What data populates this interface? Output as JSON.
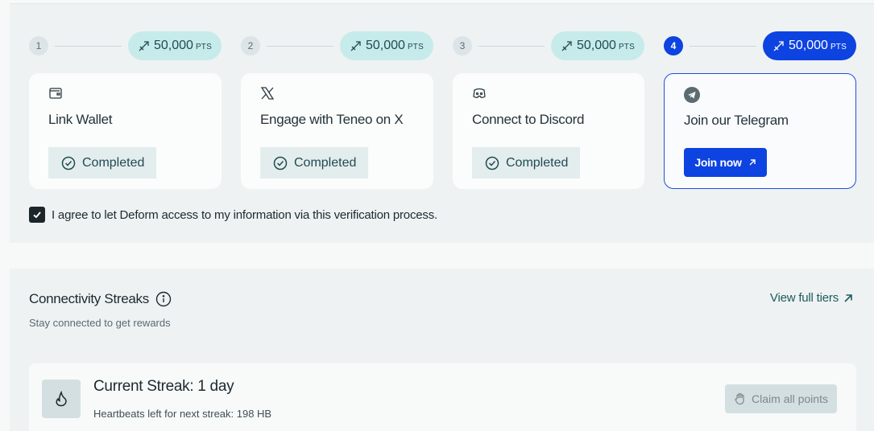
{
  "steps": [
    {
      "number": "1",
      "points": "50,000",
      "unit": "PTS",
      "title": "Link Wallet",
      "icon": "wallet-icon",
      "status": "Completed"
    },
    {
      "number": "2",
      "points": "50,000",
      "unit": "PTS",
      "title": "Engage with Teneo on X",
      "icon": "x-logo-icon",
      "status": "Completed"
    },
    {
      "number": "3",
      "points": "50,000",
      "unit": "PTS",
      "title": "Connect to Discord",
      "icon": "discord-icon",
      "status": "Completed"
    },
    {
      "number": "4",
      "points": "50,000",
      "unit": "PTS",
      "title": "Join our Telegram",
      "icon": "telegram-icon",
      "action": "Join now"
    }
  ],
  "agreement": {
    "checked": true,
    "text": "I agree to let Deform access to my information via this verification process."
  },
  "streaks": {
    "title": "Connectivity Streaks",
    "subtitle": "Stay connected to get rewards",
    "view_tiers": "View full tiers",
    "current": "Current Streak: 1 day",
    "heartbeats": "Heartbeats left for next streak: 198 HB",
    "claim": "Claim all points"
  },
  "colors": {
    "accent": "#0d43e0",
    "pill": "#c7ebea",
    "panel": "#eef2f3"
  }
}
